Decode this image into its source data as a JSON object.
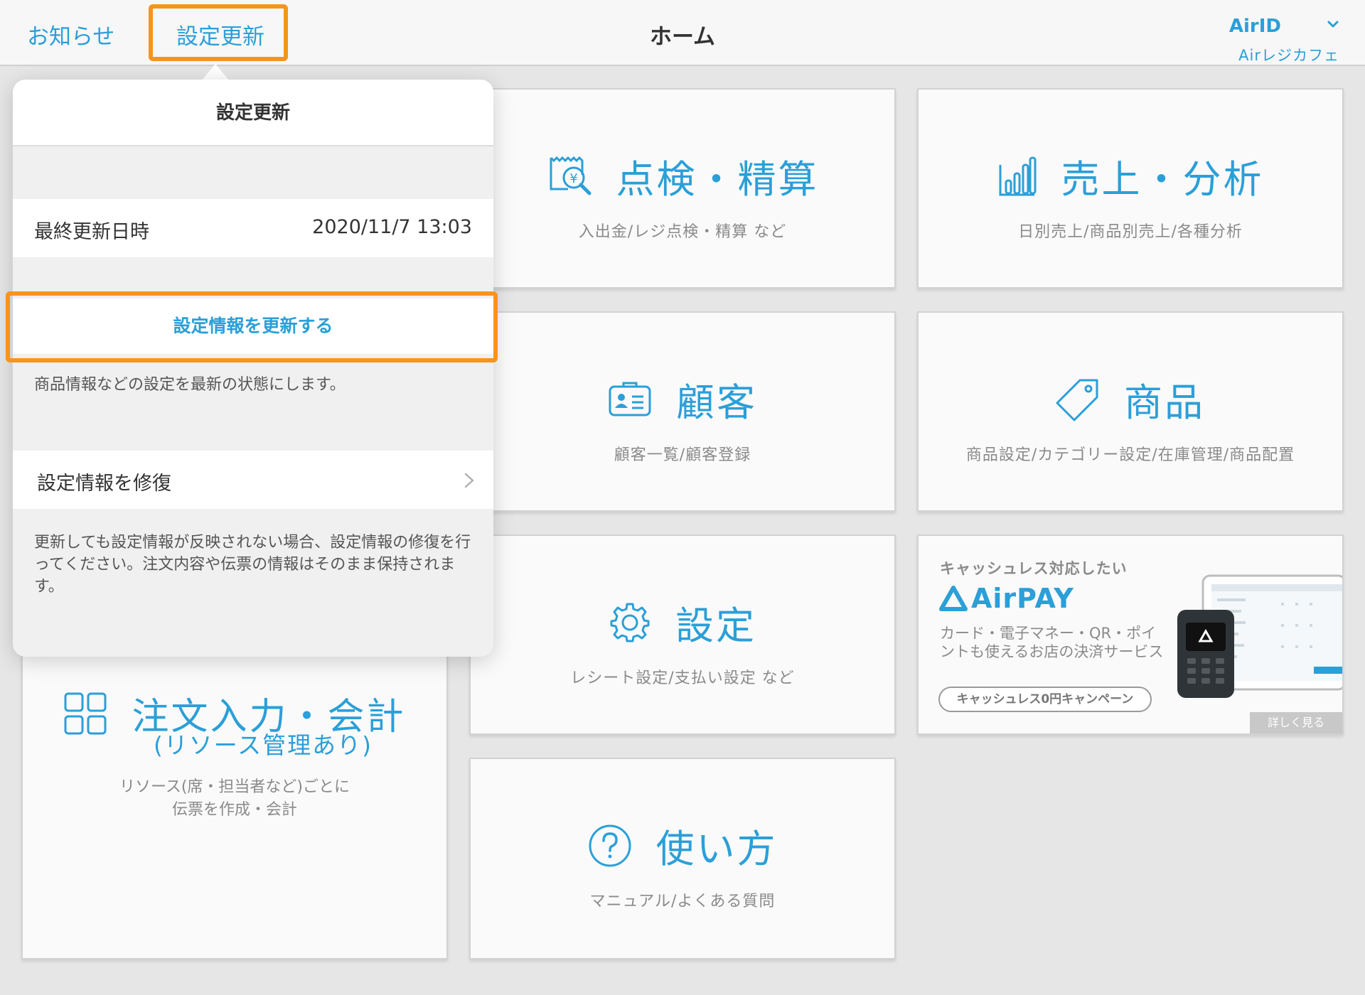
{
  "header": {
    "news_label": "お知らせ",
    "update_label": "設定更新",
    "title": "ホーム",
    "account_id": "AirID",
    "account_store": "Airレジカフェ"
  },
  "tiles": {
    "inspection": {
      "title": "点検・精算",
      "subtitle": "入出金/レジ点検・精算 など"
    },
    "sales": {
      "title": "売上・分析",
      "subtitle": "日別売上/商品別売上/各種分析"
    },
    "customer": {
      "title": "顧客",
      "subtitle": "顧客一覧/顧客登録"
    },
    "product": {
      "title": "商品",
      "subtitle": "商品設定/カテゴリー設定/在庫管理/商品配置"
    },
    "settings": {
      "title": "設定",
      "subtitle": "レシート設定/支払い設定 など"
    },
    "howto": {
      "title": "使い方",
      "subtitle": "マニュアル/よくある質問"
    },
    "order": {
      "title": "注文入力・会計",
      "title_sub": "(リソース管理あり)",
      "desc_line1": "リソース(席・担当者など)ごとに",
      "desc_line2": "伝票を作成・会計"
    }
  },
  "ad": {
    "headline": "キャッシュレス対応したい",
    "logo_text": "AirPAY",
    "body": "カード・電子マネー・QR・ポイントも使えるお店の決済サービス",
    "campaign": "キャッシュレス0円キャンペーン",
    "more": "詳しく見る"
  },
  "popover": {
    "title": "設定更新",
    "last_update_label": "最終更新日時",
    "last_update_value": "2020/11/7 13:03",
    "update_button": "設定情報を更新する",
    "update_note": "商品情報などの設定を最新の状態にします。",
    "repair_label": "設定情報を修復",
    "repair_note": "更新しても設定情報が反映されない場合、設定情報の修復を行ってください。注文内容や伝票の情報はそのまま保持されます。"
  },
  "colors": {
    "accent": "#2b9fd8",
    "highlight": "#f7941d",
    "background": "#e6e6e6"
  },
  "icons": {
    "inspection": "receipt-magnifier-icon",
    "sales": "bar-chart-icon",
    "customer": "id-card-icon",
    "product": "price-tag-icon",
    "settings": "gear-icon",
    "howto": "question-circle-icon",
    "order": "grid-icon",
    "account": "chevron-down-icon",
    "repair": "chevron-right-icon"
  }
}
